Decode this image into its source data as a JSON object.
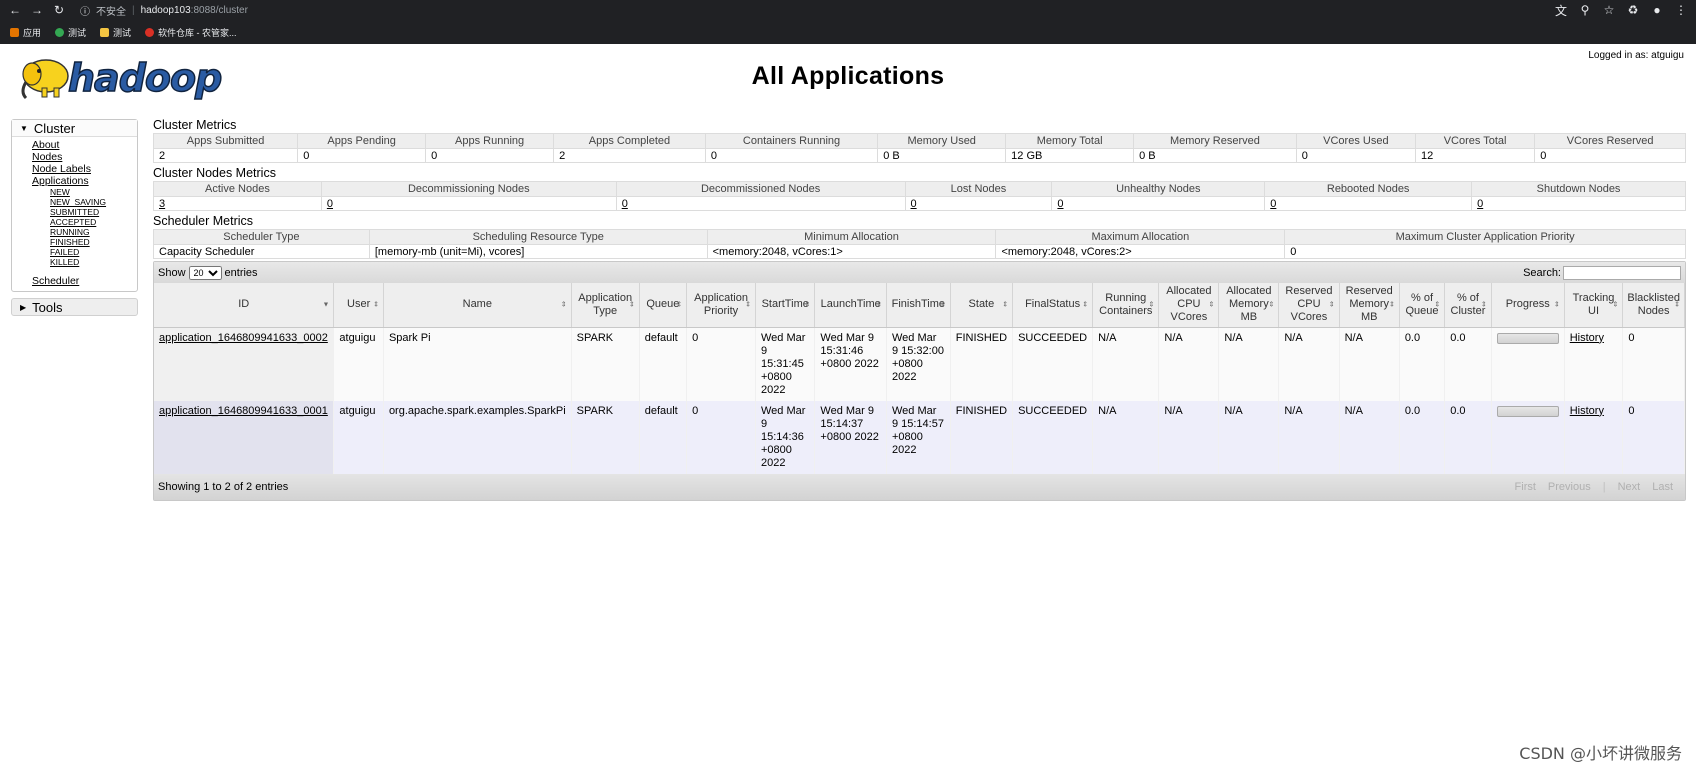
{
  "browser": {
    "insecure_label": "不安全",
    "url_host": "hadoop103",
    "url_path": ":8088/cluster",
    "bookmarks": [
      "应用",
      "测试",
      "测试",
      "软件仓库 - 农管家..."
    ]
  },
  "header": {
    "logo_text": "hadoop",
    "title": "All Applications",
    "logged_in": "Logged in as: atguigu"
  },
  "sidebar": {
    "cluster_label": "Cluster",
    "links": [
      "About",
      "Nodes",
      "Node Labels",
      "Applications"
    ],
    "app_states": [
      "NEW",
      "NEW_SAVING",
      "SUBMITTED",
      "ACCEPTED",
      "RUNNING",
      "FINISHED",
      "FAILED",
      "KILLED"
    ],
    "scheduler_link": "Scheduler",
    "tools_label": "Tools"
  },
  "cluster_metrics": {
    "title": "Cluster Metrics",
    "headers": [
      "Apps Submitted",
      "Apps Pending",
      "Apps Running",
      "Apps Completed",
      "Containers Running",
      "Memory Used",
      "Memory Total",
      "Memory Reserved",
      "VCores Used",
      "VCores Total",
      "VCores Reserved"
    ],
    "values": [
      "2",
      "0",
      "0",
      "2",
      "0",
      "0 B",
      "12 GB",
      "0 B",
      "0",
      "12",
      "0"
    ]
  },
  "node_metrics": {
    "title": "Cluster Nodes Metrics",
    "headers": [
      "Active Nodes",
      "Decommissioning Nodes",
      "Decommissioned Nodes",
      "Lost Nodes",
      "Unhealthy Nodes",
      "Rebooted Nodes",
      "Shutdown Nodes"
    ],
    "values": [
      "3",
      "0",
      "0",
      "0",
      "0",
      "0",
      "0"
    ]
  },
  "scheduler_metrics": {
    "title": "Scheduler Metrics",
    "headers": [
      "Scheduler Type",
      "Scheduling Resource Type",
      "Minimum Allocation",
      "Maximum Allocation",
      "Maximum Cluster Application Priority"
    ],
    "values": [
      "Capacity Scheduler",
      "[memory-mb (unit=Mi), vcores]",
      "<memory:2048, vCores:1>",
      "<memory:2048, vCores:2>",
      "0"
    ]
  },
  "apps": {
    "show_label": "Show",
    "entries_value": "20",
    "entries_label": "entries",
    "search_label": "Search:",
    "headers": [
      "ID",
      "User",
      "Name",
      "Application Type",
      "Queue",
      "Application Priority",
      "StartTime",
      "LaunchTime",
      "FinishTime",
      "State",
      "FinalStatus",
      "Running Containers",
      "Allocated CPU VCores",
      "Allocated Memory MB",
      "Reserved CPU VCores",
      "Reserved Memory MB",
      "% of Queue",
      "% of Cluster",
      "Progress",
      "Tracking UI",
      "Blacklisted Nodes"
    ],
    "rows": [
      {
        "id": "application_1646809941633_0002",
        "user": "atguigu",
        "name": "Spark Pi",
        "type": "SPARK",
        "queue": "default",
        "priority": "0",
        "start": "Wed Mar 9 15:31:45 +0800 2022",
        "launch": "Wed Mar 9 15:31:46 +0800 2022",
        "finish": "Wed Mar 9 15:32:00 +0800 2022",
        "state": "FINISHED",
        "final": "SUCCEEDED",
        "running": "N/A",
        "alloc_cpu": "N/A",
        "alloc_mem": "N/A",
        "res_cpu": "N/A",
        "res_mem": "N/A",
        "pct_queue": "0.0",
        "pct_cluster": "0.0",
        "progress": 0,
        "tracking": "History",
        "blacklisted": "0"
      },
      {
        "id": "application_1646809941633_0001",
        "user": "atguigu",
        "name": "org.apache.spark.examples.SparkPi",
        "type": "SPARK",
        "queue": "default",
        "priority": "0",
        "start": "Wed Mar 9 15:14:36 +0800 2022",
        "launch": "Wed Mar 9 15:14:37 +0800 2022",
        "finish": "Wed Mar 9 15:14:57 +0800 2022",
        "state": "FINISHED",
        "final": "SUCCEEDED",
        "running": "N/A",
        "alloc_cpu": "N/A",
        "alloc_mem": "N/A",
        "res_cpu": "N/A",
        "res_mem": "N/A",
        "pct_queue": "0.0",
        "pct_cluster": "0.0",
        "progress": 0,
        "tracking": "History",
        "blacklisted": "0"
      }
    ],
    "footer": "Showing 1 to 2 of 2 entries",
    "pager": [
      "First",
      "Previous",
      "|",
      "Next",
      "Last"
    ]
  },
  "watermark": "CSDN @小坏讲微服务"
}
